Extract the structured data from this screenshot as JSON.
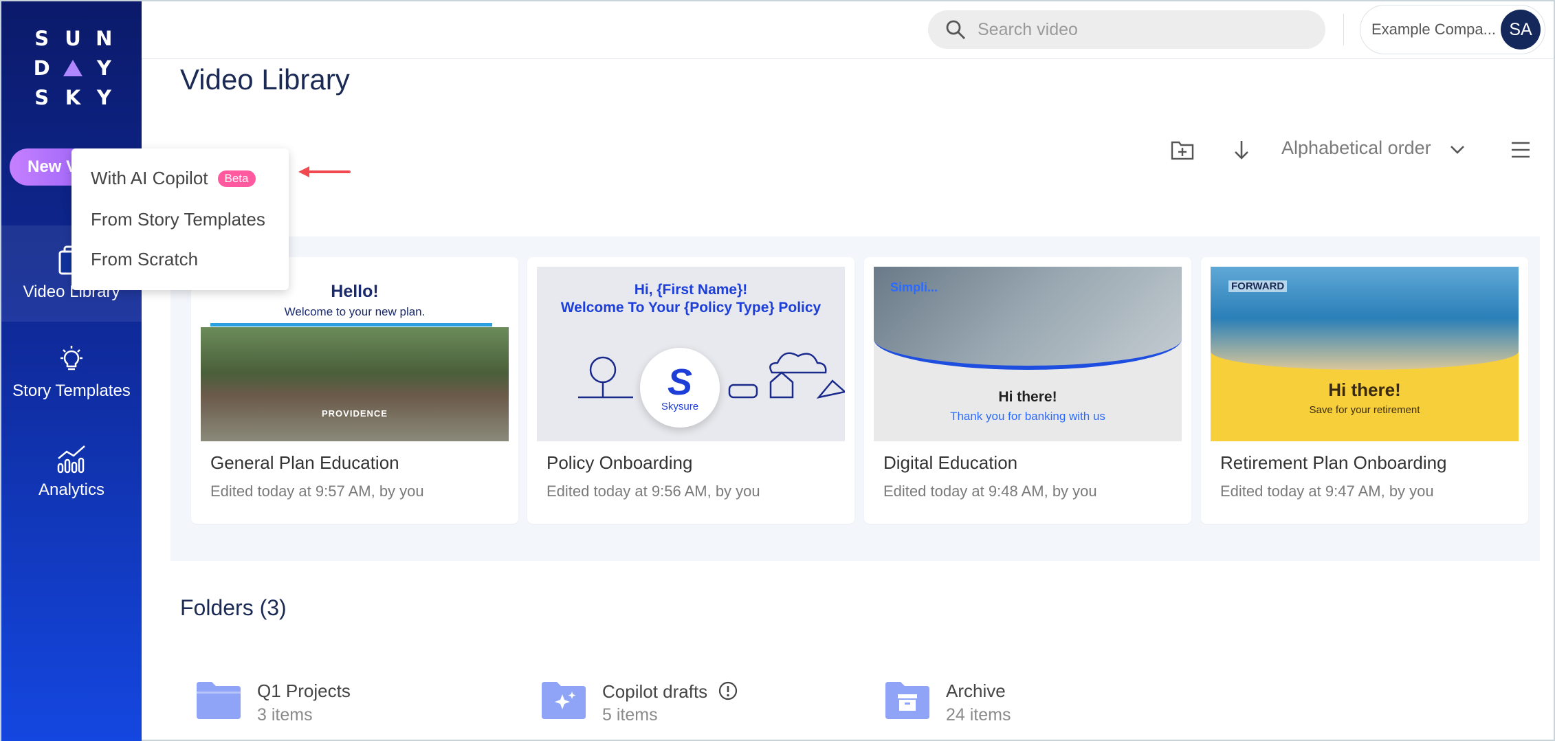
{
  "sidebar": {
    "logo_letters": [
      "S",
      "U",
      "N",
      "D",
      "",
      "Y",
      "S",
      "K",
      "Y"
    ],
    "new_video_label": "New Video",
    "items": [
      {
        "label": "Video Library",
        "icon": "video-library-icon",
        "active": true
      },
      {
        "label": "Story Templates",
        "icon": "lightbulb-icon",
        "active": false
      },
      {
        "label": "Analytics",
        "icon": "analytics-icon",
        "active": false
      }
    ]
  },
  "header": {
    "search_placeholder": "Search video",
    "company": "Example Compa...",
    "avatar_initials": "SA"
  },
  "main": {
    "title": "Video Library",
    "sort_label": "Alphabetical order",
    "videos": [
      {
        "title": "General Plan Education",
        "edited": "Edited today at 9:57 AM, by you",
        "thumb": {
          "headline": "Hello!",
          "subline": "Welcome to your new plan.",
          "brand": "PROVIDENCE"
        }
      },
      {
        "title": "Policy Onboarding",
        "edited": "Edited today at 9:56 AM, by you",
        "thumb": {
          "line1": "Hi, {First Name}!",
          "line2": "Welcome To Your {Policy Type} Policy",
          "logo_letter": "S",
          "logo_name": "Skysure"
        }
      },
      {
        "title": "Digital Education",
        "edited": "Edited today at 9:48 AM, by you",
        "thumb": {
          "brand": "Simpli...",
          "headline": "Hi there!",
          "subline": "Thank you for banking with us"
        }
      },
      {
        "title": "Retirement Plan Onboarding",
        "edited": "Edited today at 9:47 AM, by you",
        "thumb": {
          "brand": "FORWARD",
          "headline": "Hi there!",
          "subline": "Save for your retirement"
        }
      }
    ],
    "folders_title": "Folders (3)",
    "folders": [
      {
        "name": "Q1 Projects",
        "count": "3 items",
        "icon": "folder-icon"
      },
      {
        "name": "Copilot drafts",
        "count": "5 items",
        "icon": "sparkle-folder-icon"
      },
      {
        "name": "Archive",
        "count": "24 items",
        "icon": "archive-folder-icon"
      }
    ]
  },
  "dropdown": {
    "items": [
      "With AI Copilot",
      "From Story Templates",
      "From Scratch"
    ],
    "beta_label": "Beta"
  },
  "colors": {
    "sidebar_top": "#0b1a6a",
    "sidebar_bottom": "#1447e0",
    "new_button": "#b070ff",
    "beta_badge": "#ff5aa0",
    "annotation_arrow": "#f04a50",
    "folder_icon": "#8fa3f7"
  }
}
